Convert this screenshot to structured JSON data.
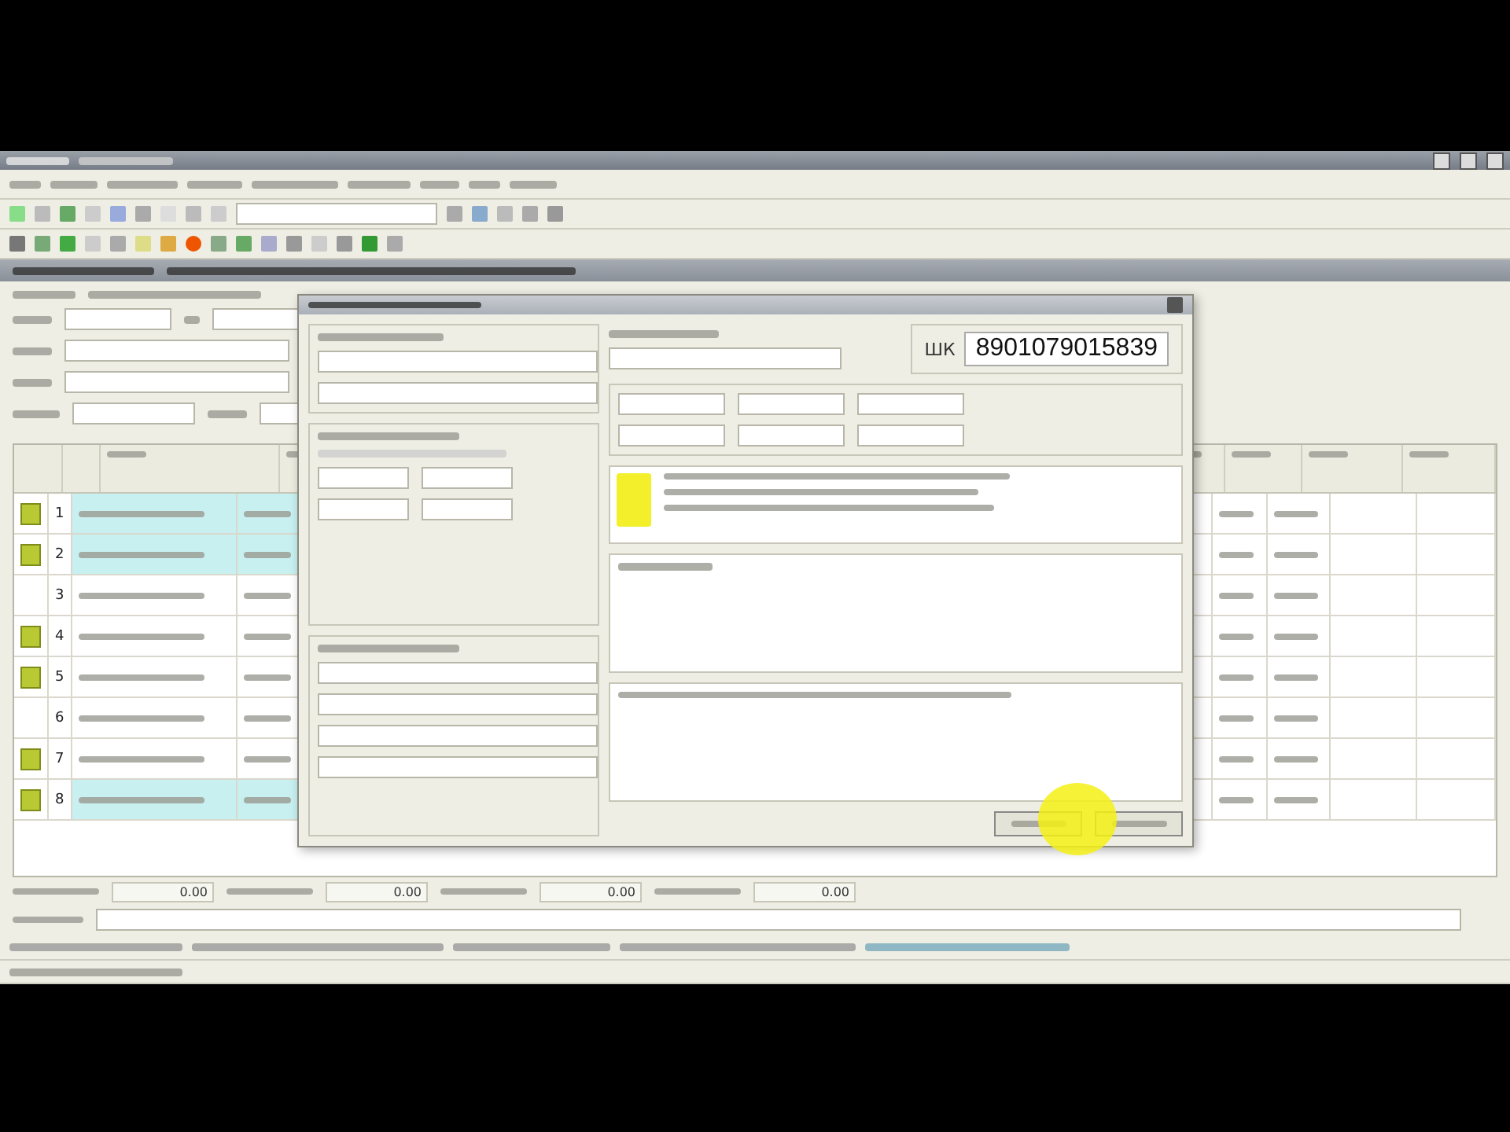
{
  "barcode": {
    "label": "ШК",
    "value": "8901079015839"
  },
  "rows": [
    {
      "number": "1",
      "marked": true,
      "highlighted": true
    },
    {
      "number": "2",
      "marked": true,
      "highlighted": true
    },
    {
      "number": "3",
      "marked": false,
      "highlighted": false
    },
    {
      "number": "4",
      "marked": true,
      "highlighted": false
    },
    {
      "number": "5",
      "marked": true,
      "highlighted": false
    },
    {
      "number": "6",
      "marked": false,
      "highlighted": false
    },
    {
      "number": "7",
      "marked": true,
      "highlighted": false
    },
    {
      "number": "8",
      "marked": true,
      "highlighted": true
    }
  ],
  "totals": [
    "0.00",
    "0.00",
    "0.00",
    "0.00"
  ]
}
